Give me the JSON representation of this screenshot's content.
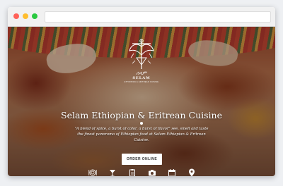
{
  "browser": {
    "address": ""
  },
  "logo": {
    "amharic": "ሰላም",
    "name": "SELAM",
    "tagline": "ETHIOPIAN & ERITREAN CUISINE"
  },
  "hero": {
    "title": "Selam Ethiopian & Eritrean Cuisine",
    "description": "\"A blend of spice, a burst of color, a burst of flavor\" see, smell and taste the finest panorama of Ethiopian food at Selam Ethiopian & Eritrean Cuisine.",
    "order_button": "ORDER ONLINE"
  },
  "icons": [
    "plate-icon",
    "cocktail-icon",
    "clipboard-icon",
    "camera-icon",
    "calendar-icon",
    "map-pin-icon"
  ]
}
